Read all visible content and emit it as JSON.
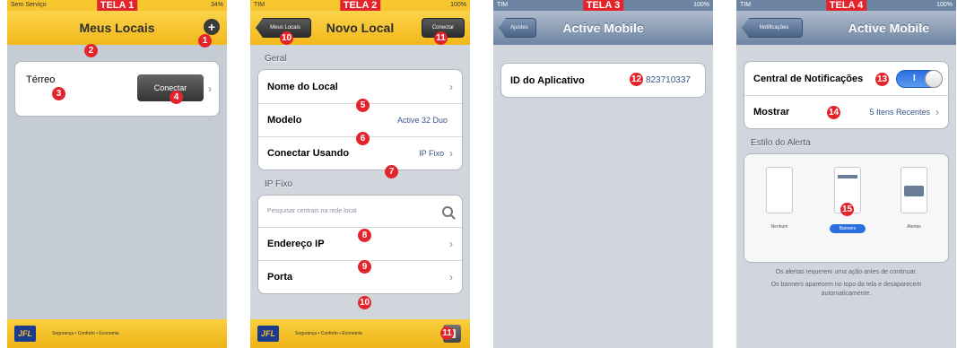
{
  "screens": [
    {
      "tag": "TELA 1",
      "carrier": "Sem Serviço",
      "battery": "34%",
      "nav_title": "Meus Locais",
      "location": {
        "name": "Térreo",
        "button": "Conectar"
      },
      "footer_logo": "JFL",
      "footer_tagline": "Segurança • Conforto • Economia"
    },
    {
      "tag": "TELA 2",
      "carrier": "TIM",
      "battery": "100%",
      "nav_title": "Novo Local",
      "back_label": "Meus Locais",
      "right_label": "Conectar",
      "section_general": "Geral",
      "rows_general": [
        {
          "label": "Nome do Local",
          "value": ""
        },
        {
          "label": "Modelo",
          "value": "Active 32 Duo"
        },
        {
          "label": "Conectar Usando",
          "value": "IP Fixo"
        }
      ],
      "section_ip": "IP Fixo",
      "search_placeholder": "Pesquisar centrais na rede local",
      "rows_ip": [
        {
          "label": "Endereço IP",
          "value": ""
        },
        {
          "label": "Porta",
          "value": ""
        }
      ],
      "footer_logo": "JFL",
      "footer_tagline": "Segurança • Conforto • Economia"
    },
    {
      "tag": "TELA 3",
      "carrier": "TIM",
      "battery": "100%",
      "nav_title": "Active Mobile",
      "back_label": "Ajustes",
      "app_id_label": "ID do Aplicativo",
      "app_id_value": "823710337"
    },
    {
      "tag": "TELA 4",
      "carrier": "TIM",
      "battery": "100%",
      "nav_title": "Active Mobile",
      "back_label": "Notificações",
      "notif_label": "Central de Notificações",
      "toggle_label": "I",
      "show_label": "Mostrar",
      "show_value": "5 Itens Recentes",
      "section_alert": "Estilo do Alerta",
      "alert_options": [
        "Nenhum",
        "Banners",
        "Alertas"
      ],
      "alert_selected": "Banners",
      "alert_desc_1": "Os alertas requerem uma ação antes de continuar.",
      "alert_desc_2": "Os banners aparecem no topo da tela e desaparecem automaticamente."
    }
  ],
  "markers": [
    "1",
    "2",
    "3",
    "4",
    "5",
    "6",
    "7",
    "8",
    "9",
    "10",
    "10",
    "11",
    "11",
    "12",
    "13",
    "14",
    "15"
  ]
}
